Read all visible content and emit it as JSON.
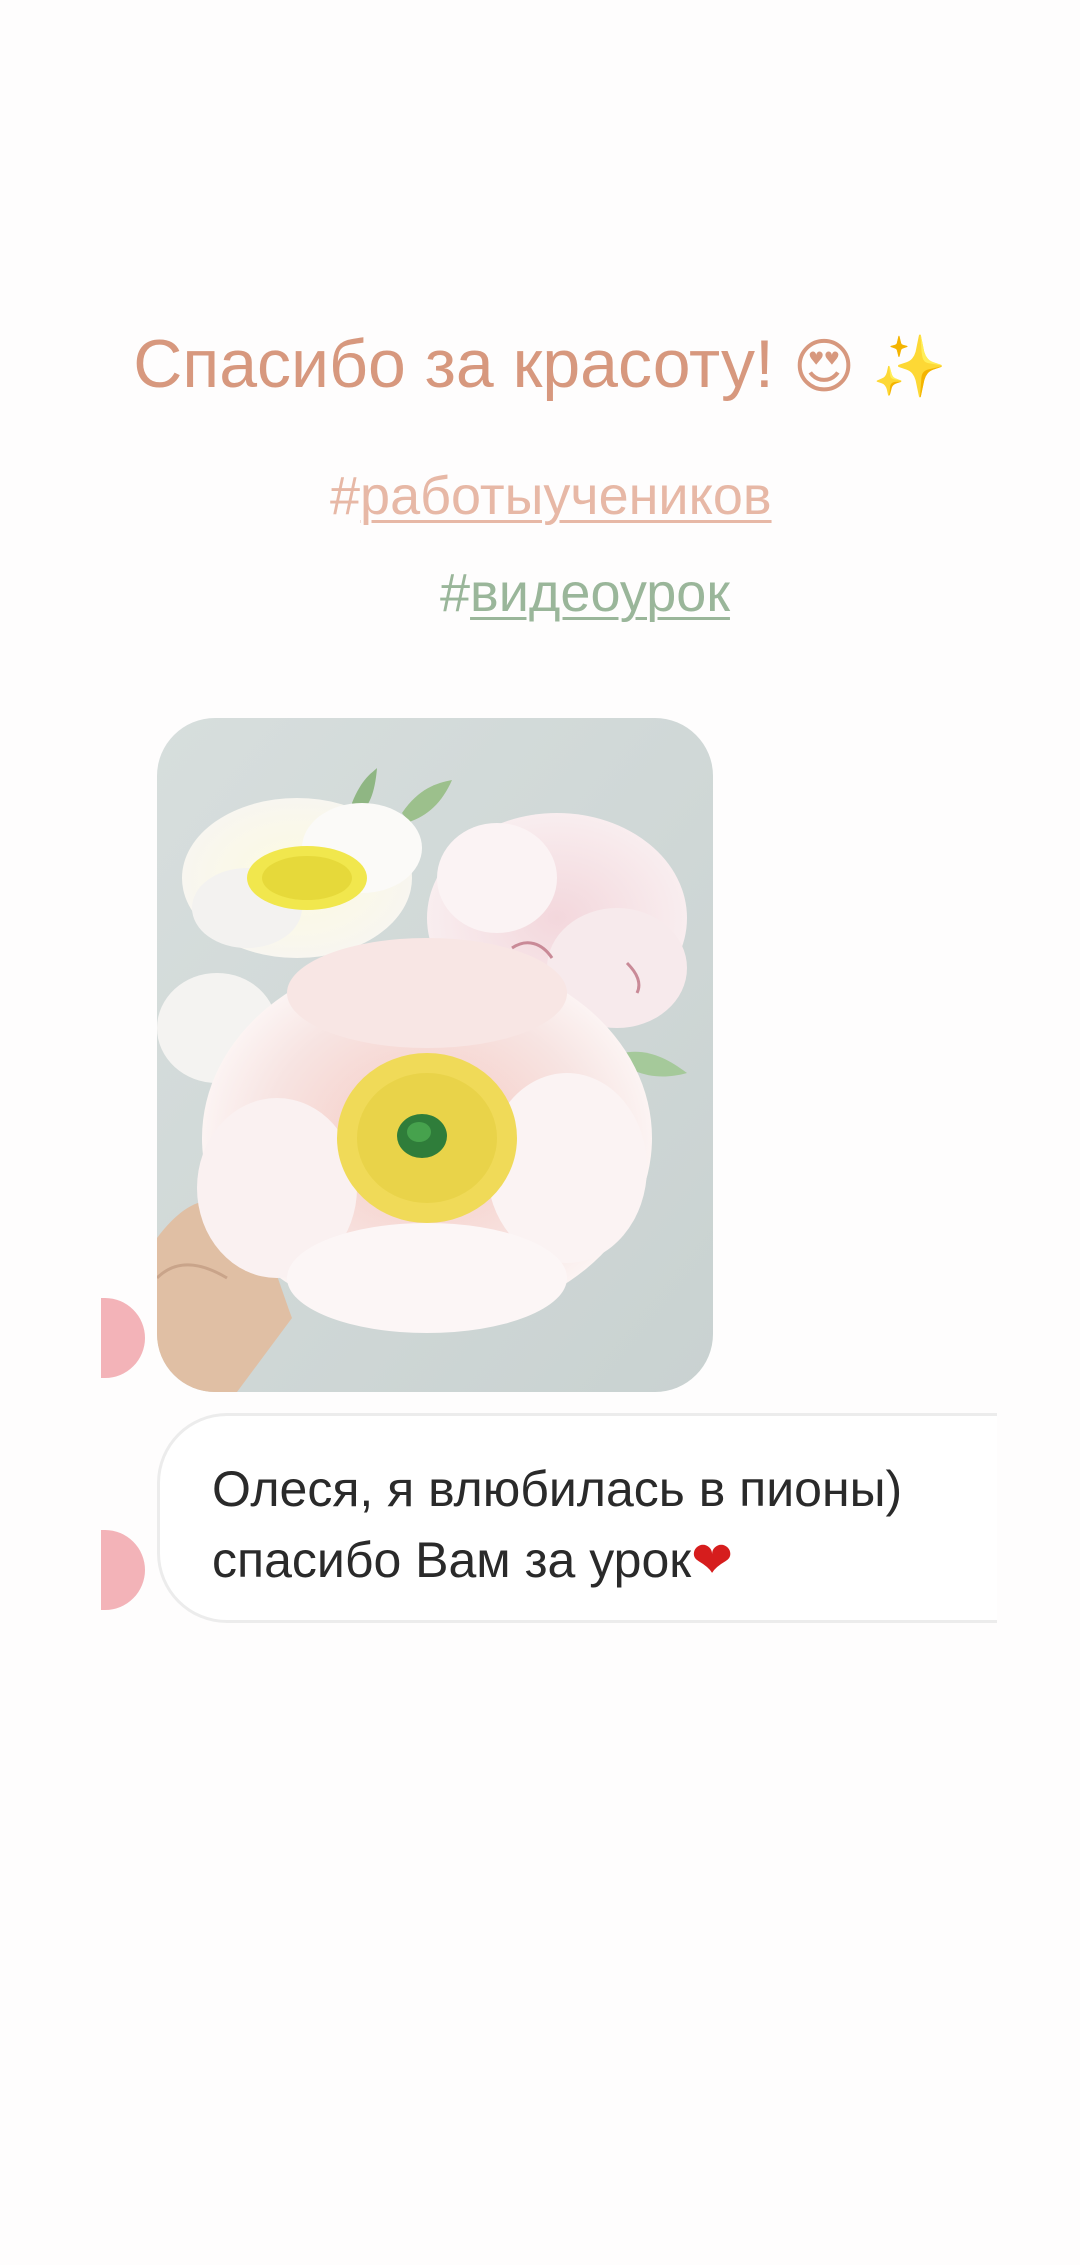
{
  "story": {
    "title": "Спасибо за красоту!",
    "title_emoji": "😍 ✨",
    "hashtags": [
      {
        "hash": "#",
        "word": "работыучеников"
      },
      {
        "hash": "#",
        "word": "видеоурок"
      }
    ]
  },
  "message": {
    "line1": "Олеся, я влюбилась в пионы)",
    "line2": "спасибо Вам за урок",
    "line2_emoji": "❤"
  },
  "colors": {
    "title": "#d7987e",
    "hashtag1": "#e7b8a6",
    "hashtag2": "#9ab69a",
    "avatar": "#f3b3b8"
  },
  "icons": {
    "photo": "peony-flowers-photo",
    "avatar": "user-avatar"
  }
}
